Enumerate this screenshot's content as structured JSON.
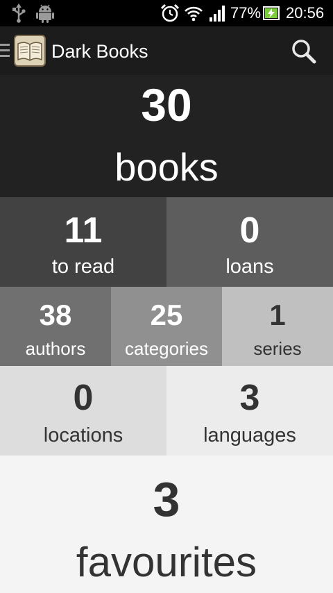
{
  "status_bar": {
    "icons": [
      "usb-icon",
      "android-debug-icon",
      "alarm-clock-icon",
      "wifi-icon",
      "signal-icon",
      "battery-charging-icon"
    ],
    "battery_percent": "77%",
    "time": "20:56"
  },
  "action_bar": {
    "title": "Dark Books",
    "icons": [
      "drawer-indicator-icon",
      "app-logo-book-icon",
      "search-icon"
    ]
  },
  "tiles": {
    "books": {
      "count": "30",
      "label": "books",
      "color": "#222222"
    },
    "to_read": {
      "count": "11",
      "label": "to read",
      "color": "#424242"
    },
    "loans": {
      "count": "0",
      "label": "loans",
      "color": "#5d5d5d"
    },
    "authors": {
      "count": "38",
      "label": "authors",
      "color": "#707070"
    },
    "categories": {
      "count": "25",
      "label": "categories",
      "color": "#909090"
    },
    "series": {
      "count": "1",
      "label": "series",
      "color": "#c0c0c0"
    },
    "locations": {
      "count": "0",
      "label": "locations",
      "color": "#dddddd"
    },
    "languages": {
      "count": "3",
      "label": "languages",
      "color": "#ececec"
    },
    "favourites": {
      "count": "3",
      "label": "favourites",
      "color": "#f4f4f4"
    }
  }
}
